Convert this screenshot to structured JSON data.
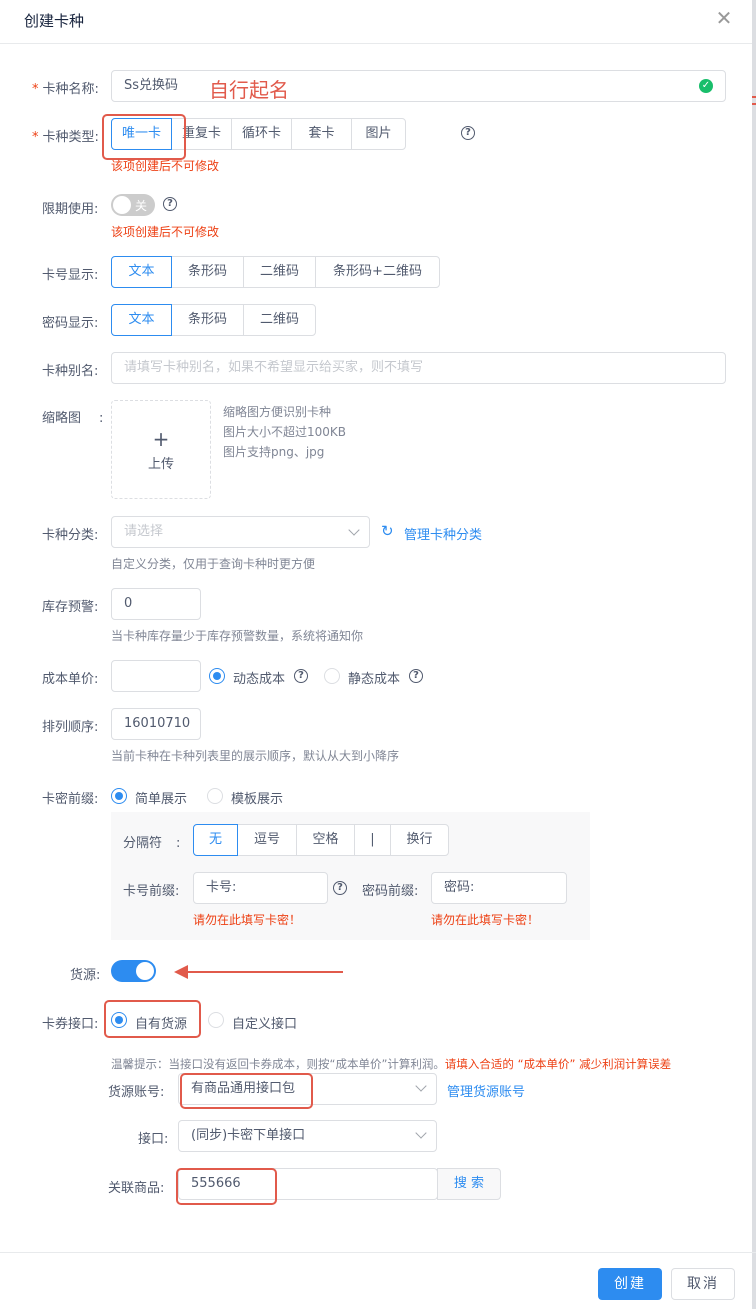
{
  "dialog": {
    "title": "创建卡种",
    "close_glyph": "✕"
  },
  "name_field": {
    "label": "卡种名称:",
    "value": "Ss兑换码",
    "annotation": "自行起名"
  },
  "card_type": {
    "label": "卡种类型:",
    "options": [
      "唯一卡",
      "重复卡",
      "循环卡",
      "套卡",
      "图片"
    ],
    "selected": "唯一卡",
    "hint": "该项创建后不可修改"
  },
  "time_limit": {
    "label": "限期使用:",
    "toggle_text": "关",
    "state": "off",
    "hint": "该项创建后不可修改"
  },
  "card_number_display": {
    "label": "卡号显示:",
    "options": [
      "文本",
      "条形码",
      "二维码",
      "条形码+二维码"
    ],
    "selected": "文本"
  },
  "password_display": {
    "label": "密码显示:",
    "options": [
      "文本",
      "条形码",
      "二维码"
    ],
    "selected": "文本"
  },
  "alias": {
    "label": "卡种别名:",
    "placeholder": "请填写卡种别名，如果不希望显示给买家，则不填写"
  },
  "thumbnail": {
    "label": "缩略图",
    "colon": ":",
    "upload_plus": "+",
    "upload_text": "上传",
    "tips": [
      "缩略图方便识别卡种",
      "图片大小不超过100KB",
      "图片支持png、jpg"
    ]
  },
  "category": {
    "label": "卡种分类:",
    "placeholder": "请选择",
    "manage_link": "管理卡种分类",
    "hint": "自定义分类，仅用于查询卡种时更方便"
  },
  "stock_warning": {
    "label": "库存预警:",
    "value": "0",
    "hint": "当卡种库存量少于库存预警数量，系统将通知你"
  },
  "unit_cost": {
    "label": "成本单价:",
    "value": "",
    "options": [
      "动态成本",
      "静态成本"
    ],
    "selected": "动态成本"
  },
  "sort_order": {
    "label": "排列顺序:",
    "value": "16010710",
    "hint": "当前卡种在卡种列表里的展示顺序，默认从大到小降序"
  },
  "prefix": {
    "label": "卡密前缀:",
    "options": [
      "简单展示",
      "模板展示"
    ],
    "selected": "简单展示",
    "separator_label": "分隔符",
    "separator_colon": ":",
    "separators": [
      "无",
      "逗号",
      "空格",
      "|",
      "换行"
    ],
    "separator_selected": "无",
    "card_prefix_label": "卡号前缀:",
    "card_prefix_value": "卡号:",
    "card_prefix_hint": "请勿在此填写卡密！",
    "password_prefix_label": "密码前缀:",
    "password_prefix_value": "密码:",
    "password_prefix_hint": "请勿在此填写卡密！"
  },
  "source": {
    "label": "货源:",
    "state": "on"
  },
  "interface": {
    "label": "卡券接口:",
    "options": [
      "自有货源",
      "自定义接口"
    ],
    "selected": "自有货源"
  },
  "warm_tip": {
    "gray": "温馨提示：当接口没有返回卡券成本，则按“成本单价”计算利润。",
    "red": "请填入合适的 “成本单价” 减少利润计算误差"
  },
  "source_account": {
    "label": "货源账号:",
    "value": "有商品通用接口包",
    "manage_link": "管理货源账号"
  },
  "api": {
    "label": "接口:",
    "value": "(同步)卡密下单接口"
  },
  "linked_product": {
    "label": "关联商品:",
    "value": "555666",
    "search_button": "搜 索"
  },
  "footer": {
    "create": "创建",
    "cancel": "取消"
  },
  "colors": {
    "primary": "#2d8cf0",
    "danger": "#ed4014",
    "annotation": "#e15a4b",
    "success": "#19be6b"
  }
}
